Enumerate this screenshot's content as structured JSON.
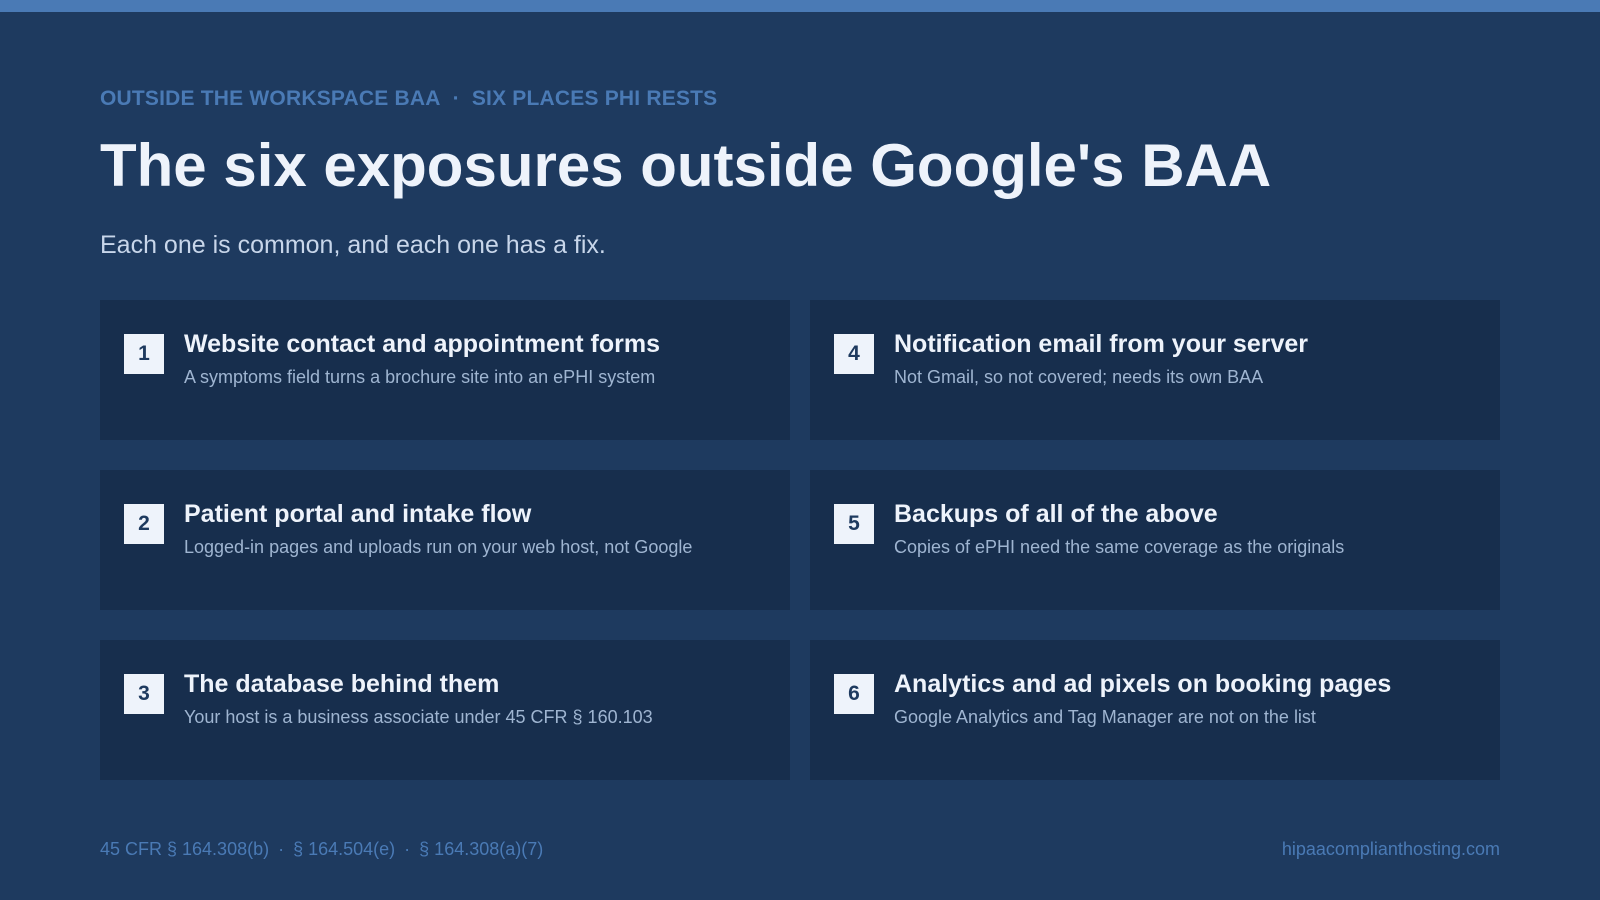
{
  "colors": {
    "background": "#1e3a5f",
    "accent": "#4a7ab5",
    "card": "#172e4d",
    "heading": "#eef3fb",
    "muted": "#9fb5d1"
  },
  "header": {
    "eyebrow_left": "OUTSIDE THE WORKSPACE BAA",
    "eyebrow_separator": "·",
    "eyebrow_right": "SIX PLACES PHI RESTS",
    "title": "The six exposures outside Google's BAA",
    "subtitle": "Each one is common, and each one has a fix."
  },
  "cards": [
    {
      "number": "1",
      "title": "Website contact and appointment forms",
      "description": "A symptoms field turns a brochure site into an ePHI system"
    },
    {
      "number": "2",
      "title": "Patient portal and intake flow",
      "description": "Logged-in pages and uploads run on your web host, not Google"
    },
    {
      "number": "3",
      "title": "The database behind them",
      "description": "Your host is a business associate under 45 CFR § 160.103"
    },
    {
      "number": "4",
      "title": "Notification email from your server",
      "description": "Not Gmail, so not covered; needs its own BAA"
    },
    {
      "number": "5",
      "title": "Backups of all of the above",
      "description": "Copies of ePHI need the same coverage as the originals"
    },
    {
      "number": "6",
      "title": "Analytics and ad pixels on booking pages",
      "description": "Google Analytics and Tag Manager are not on the list"
    }
  ],
  "footer": {
    "citations": [
      "45 CFR § 164.308(b)",
      "§ 164.504(e)",
      "§ 164.308(a)(7)"
    ],
    "separator": "·",
    "site": "hipaacomplianthosting.com"
  }
}
